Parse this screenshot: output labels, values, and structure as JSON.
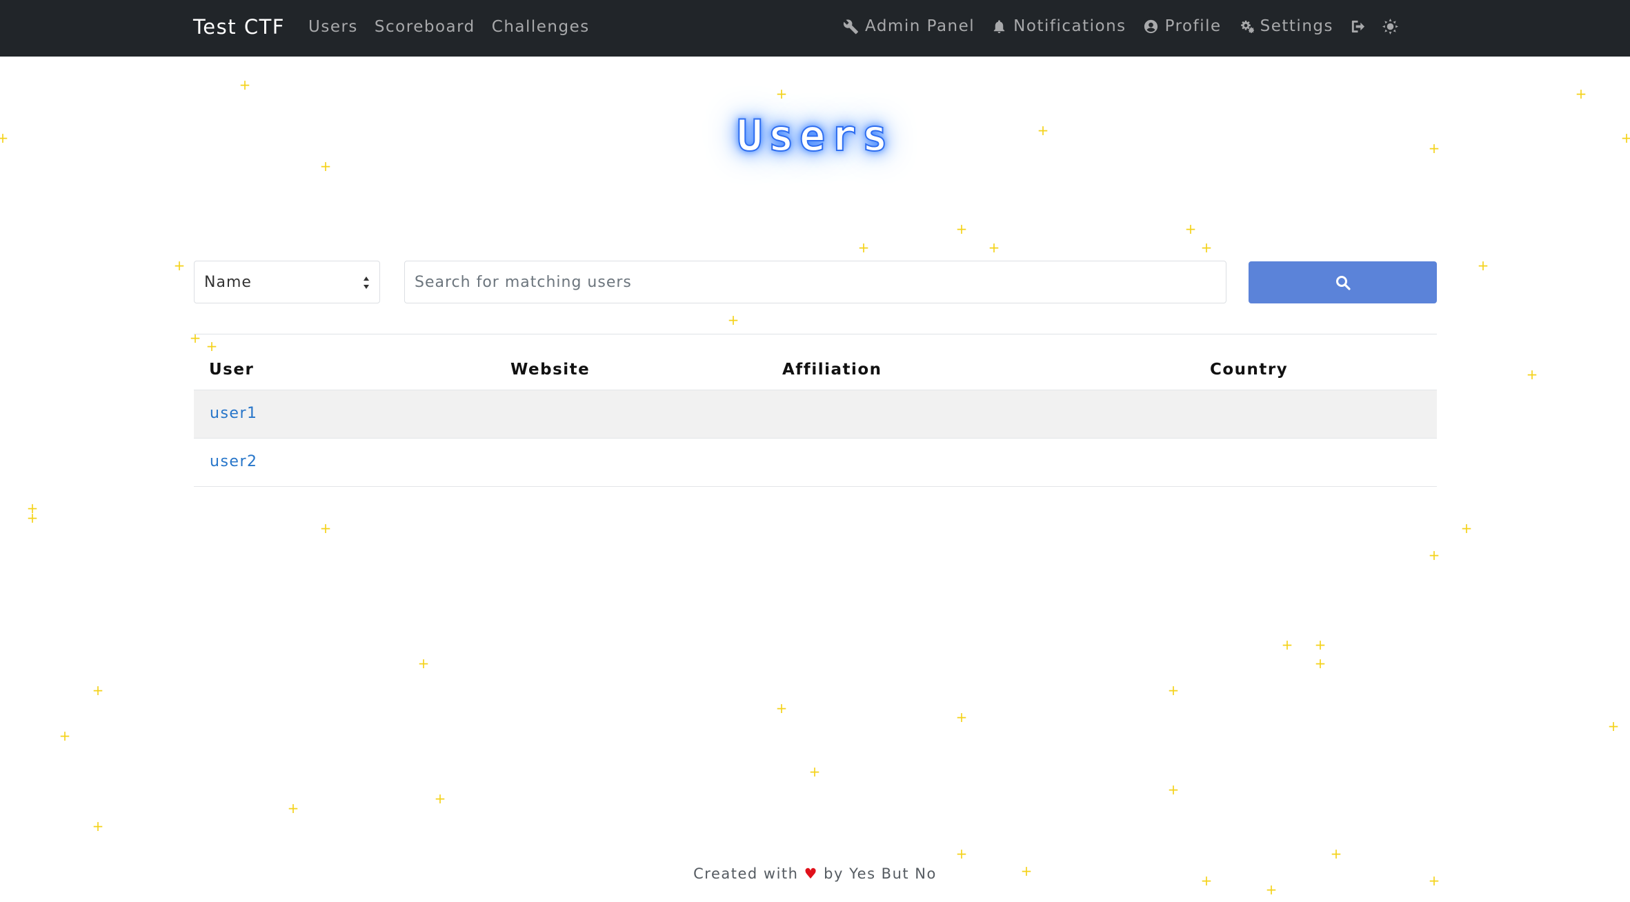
{
  "navbar": {
    "brand": "Test CTF",
    "left_links": [
      {
        "label": "Users"
      },
      {
        "label": "Scoreboard"
      },
      {
        "label": "Challenges"
      }
    ],
    "right_links": [
      {
        "label": "Admin Panel",
        "icon": "wrench-icon"
      },
      {
        "label": "Notifications",
        "icon": "bell-icon"
      },
      {
        "label": "Profile",
        "icon": "user-circle-icon"
      },
      {
        "label": "Settings",
        "icon": "cogs-icon"
      }
    ],
    "logout_icon": "sign-out-icon",
    "theme_icon": "sun-icon"
  },
  "page_title": "Users",
  "search": {
    "field_selected": "Name",
    "field_options": [
      "Name"
    ],
    "placeholder": "Search for matching users",
    "button_icon": "search-icon"
  },
  "table": {
    "headers": [
      "User",
      "Website",
      "Affiliation",
      "Country"
    ],
    "rows": [
      {
        "user": "user1",
        "website": "",
        "affiliation": "",
        "country": ""
      },
      {
        "user": "user2",
        "website": "",
        "affiliation": "",
        "country": ""
      }
    ]
  },
  "footer": {
    "prefix": "Created with",
    "heart": "♥",
    "suffix": "by Yes But No"
  },
  "colors": {
    "navbar_bg": "#212529",
    "primary_button": "#5b83d9",
    "link": "#2675c9",
    "sparkle": "#f4d21a",
    "title_glow": "#3b82ff"
  }
}
